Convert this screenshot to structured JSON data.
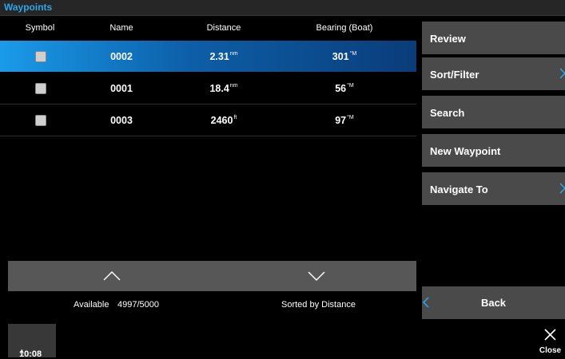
{
  "title": "Waypoints",
  "columns": {
    "symbol": "Symbol",
    "name": "Name",
    "distance": "Distance",
    "bearing": "Bearing (Boat)"
  },
  "rows": [
    {
      "name": "0002",
      "distance": "2.31",
      "distance_unit": "nm",
      "bearing": "301",
      "bearing_unit": "°M",
      "selected": true
    },
    {
      "name": "0001",
      "distance": "18.4",
      "distance_unit": "nm",
      "bearing": "56",
      "bearing_unit": "°M",
      "selected": false
    },
    {
      "name": "0003",
      "distance": "2460",
      "distance_unit": "ft",
      "bearing": "97",
      "bearing_unit": "°M",
      "selected": false
    }
  ],
  "status": {
    "available_label": "Available",
    "available_value": "4997/5000",
    "sorted": "Sorted by Distance"
  },
  "menu": {
    "review": "Review",
    "sort_filter": "Sort/Filter",
    "search": "Search",
    "new_waypoint": "New Waypoint",
    "navigate_to": "Navigate To",
    "back": "Back"
  },
  "footer": {
    "time": "10:08",
    "time_suffix": "A",
    "close": "Close"
  },
  "colors": {
    "accent": "#2da7ea",
    "selected_row": "#1a9bea",
    "button": "#4a4a4a"
  },
  "icons": {
    "up": "chevron-up-icon",
    "down": "chevron-down-icon",
    "close": "close-icon"
  }
}
